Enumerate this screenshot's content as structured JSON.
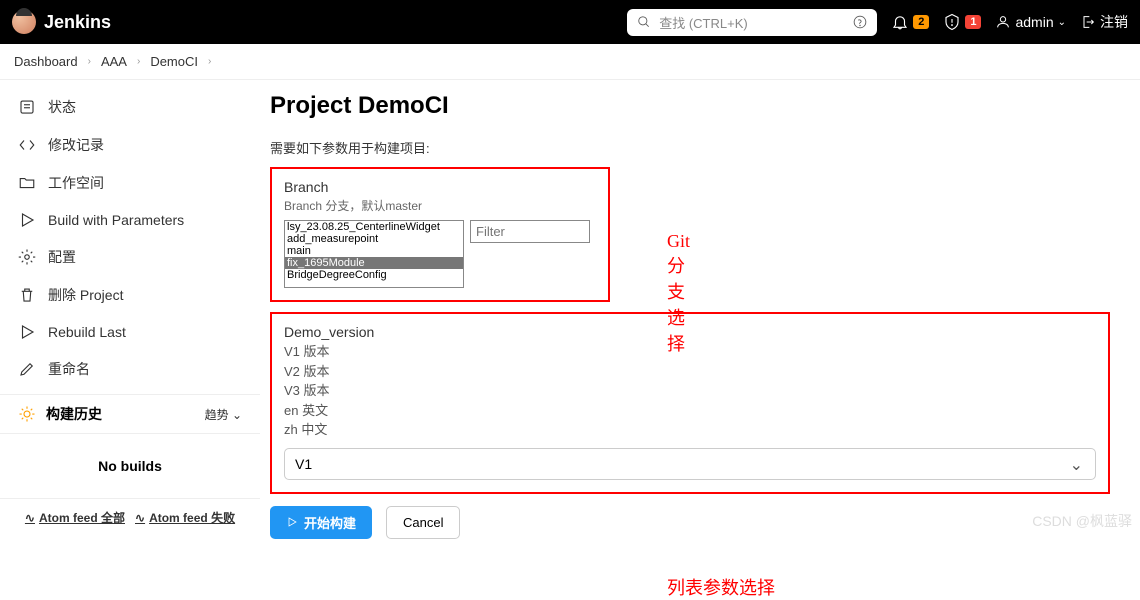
{
  "header": {
    "brand": "Jenkins",
    "search_placeholder": "查找 (CTRL+K)",
    "notif_count": "2",
    "warn_count": "1",
    "user": "admin",
    "logout": "注销"
  },
  "breadcrumbs": [
    "Dashboard",
    "AAA",
    "DemoCI"
  ],
  "sidebar": {
    "items": [
      {
        "label": "状态"
      },
      {
        "label": "修改记录"
      },
      {
        "label": "工作空间"
      },
      {
        "label": "Build with Parameters"
      },
      {
        "label": "配置"
      },
      {
        "label": "删除 Project"
      },
      {
        "label": "Rebuild Last"
      },
      {
        "label": "重命名"
      }
    ],
    "history_label": "构建历史",
    "trend_label": "趋势",
    "no_builds": "No builds",
    "feed_all": "Atom feed 全部",
    "feed_fail": "Atom feed 失败"
  },
  "main": {
    "title": "Project DemoCI",
    "params_desc": "需要如下参数用于构建项目:",
    "branch": {
      "label": "Branch",
      "desc": "Branch 分支，默认master",
      "options": [
        "lsy_23.08.25_CenterlineWidget",
        "add_measurepoint",
        "main",
        "fix_1695Module",
        "BridgeDegreeConfig"
      ],
      "selected_index": 3,
      "filter_placeholder": "Filter"
    },
    "annotation_branch": "Git分支选择",
    "demo_version": {
      "label": "Demo_version",
      "options": [
        "V1 版本",
        "V2 版本",
        "V3 版本",
        "en 英文",
        "zh 中文"
      ],
      "selected": "V1"
    },
    "annotation_list": "列表参数选择",
    "build_btn": "开始构建",
    "cancel_btn": "Cancel"
  },
  "watermark": "CSDN @枫蓝驿"
}
